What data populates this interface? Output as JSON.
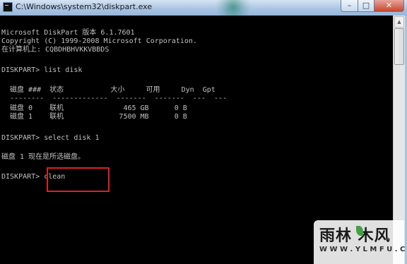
{
  "window": {
    "title": "C:\\Windows\\system32\\diskpart.exe",
    "controls": {
      "minimize": "–",
      "maximize": "□",
      "close": "✕"
    }
  },
  "console": {
    "lines": [
      "Microsoft DiskPart 版本 6.1.7601",
      "Copyright (C) 1999-2008 Microsoft Corporation.",
      "在计算机上: CQBDHBHVKKVBBDS",
      "",
      "DISKPART> list disk",
      "",
      "  磁盘 ###  状态           大小     可用     Dyn  Gpt",
      "  --------  -------------  -------  -------  ---  ---",
      "  磁盘 0    联机              465 GB      0 B",
      "  磁盘 1    联机             7500 MB      0 B",
      "",
      "DISKPART> select disk 1",
      "",
      "磁盘 1 现在是所选磁盘。",
      "",
      "DISKPART> clean"
    ]
  },
  "scrollbar": {
    "up_arrow": "▲"
  },
  "watermark": {
    "logo_text": "雨林 木风",
    "url": "W W W . Y L M F U . C O M"
  }
}
